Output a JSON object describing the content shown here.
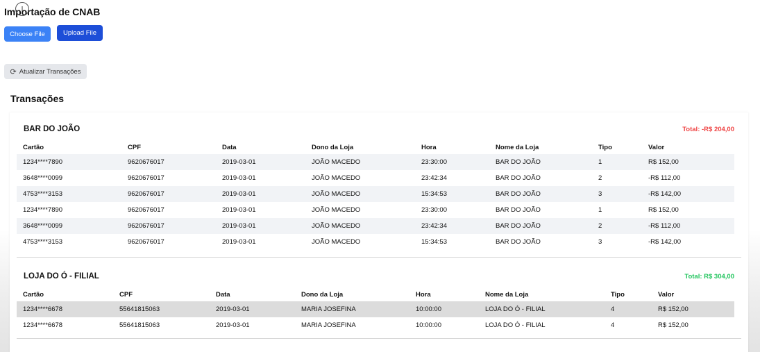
{
  "header": {
    "title": "Importação de CNAB",
    "choose_file": "Choose File",
    "upload_file": "Upload File",
    "refresh": "Atualizar Transações"
  },
  "section_title": "Transações",
  "columns": [
    "Cartão",
    "CPF",
    "Data",
    "Dono da Loja",
    "Hora",
    "Nome da Loja",
    "Tipo",
    "Valor"
  ],
  "groups": [
    {
      "name": "BAR DO JOÃO",
      "total": "Total: -R$ 204,00",
      "total_color": "#ef4444",
      "rows": [
        [
          "1234****7890",
          "9620676017",
          "2019-03-01",
          "JOÃO MACEDO",
          "23:30:00",
          "BAR DO JOÃO",
          "1",
          "R$ 152,00"
        ],
        [
          "3648****0099",
          "9620676017",
          "2019-03-01",
          "JOÃO MACEDO",
          "23:42:34",
          "BAR DO JOÃO",
          "2",
          "-R$ 112,00"
        ],
        [
          "4753****3153",
          "9620676017",
          "2019-03-01",
          "JOÃO MACEDO",
          "15:34:53",
          "BAR DO JOÃO",
          "3",
          "-R$ 142,00"
        ],
        [
          "1234****7890",
          "9620676017",
          "2019-03-01",
          "JOÃO MACEDO",
          "23:30:00",
          "BAR DO JOÃO",
          "1",
          "R$ 152,00"
        ],
        [
          "3648****0099",
          "9620676017",
          "2019-03-01",
          "JOÃO MACEDO",
          "23:42:34",
          "BAR DO JOÃO",
          "2",
          "-R$ 112,00"
        ],
        [
          "4753****3153",
          "9620676017",
          "2019-03-01",
          "JOÃO MACEDO",
          "15:34:53",
          "BAR DO JOÃO",
          "3",
          "-R$ 142,00"
        ]
      ]
    },
    {
      "name": "LOJA DO Ó - FILIAL",
      "total": "Total: R$ 304,00",
      "total_color": "#22c55e",
      "rows": [
        [
          "1234****6678",
          "55641815063",
          "2019-03-01",
          "MARIA JOSEFINA",
          "10:00:00",
          "LOJA DO Ó - FILIAL",
          "4",
          "R$ 152,00"
        ],
        [
          "1234****6678",
          "55641815063",
          "2019-03-01",
          "MARIA JOSEFINA",
          "10:00:00",
          "LOJA DO Ó - FILIAL",
          "4",
          "R$ 152,00"
        ]
      ]
    }
  ],
  "icons": {
    "refresh": "refresh-icon",
    "cursor": "text-cursor-icon"
  }
}
